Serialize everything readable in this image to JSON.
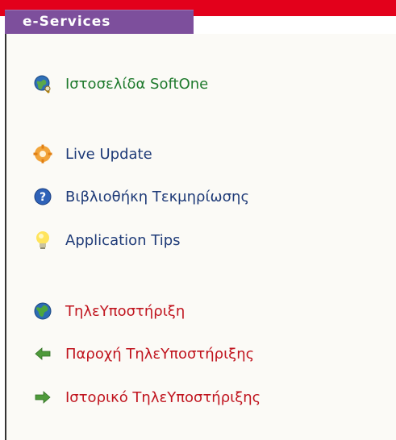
{
  "header": {
    "title": "e-Services"
  },
  "colors": {
    "accent_red": "#e3001b",
    "header_purple": "#7d4f9c",
    "link_green": "#1f7a2d",
    "link_blue": "#1f3b78",
    "link_red": "#c0141e"
  },
  "menu": {
    "group1": [
      {
        "label": "Ιστοσελίδα SoftOne",
        "icon": "globe-search-icon"
      }
    ],
    "group2": [
      {
        "label": "Live Update",
        "icon": "gear-icon"
      },
      {
        "label": "Βιβλιοθήκη Τεκμηρίωσης",
        "icon": "help-icon"
      },
      {
        "label": "Application Tips",
        "icon": "lightbulb-icon"
      }
    ],
    "group3": [
      {
        "label": "ΤηλεΥποστήριξη",
        "icon": "globe-icon"
      },
      {
        "label": "Παροχή ΤηλεΥποστήριξης",
        "icon": "arrow-left-icon"
      },
      {
        "label": "Ιστορικό ΤηλεΥποστήριξης",
        "icon": "arrow-right-icon"
      }
    ]
  }
}
